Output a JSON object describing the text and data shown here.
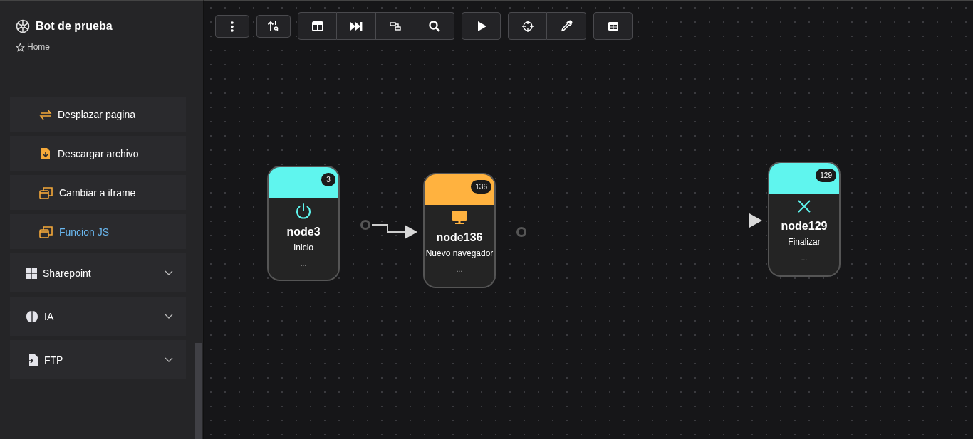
{
  "sidebar": {
    "title": "Bot de prueba",
    "breadcrumb": "Home",
    "items": [
      {
        "kind": "action",
        "label": "Desplazar pagina",
        "selected": false
      },
      {
        "kind": "action",
        "label": "Descargar archivo",
        "selected": false
      },
      {
        "kind": "action",
        "label": "Cambiar a iframe",
        "selected": false
      },
      {
        "kind": "action",
        "label": "Funcion JS",
        "selected": true
      },
      {
        "kind": "group",
        "label": "Sharepoint",
        "expanded": false
      },
      {
        "kind": "group",
        "label": "IA",
        "expanded": false
      },
      {
        "kind": "group",
        "label": "FTP",
        "expanded": false
      }
    ]
  },
  "canvas": {
    "nodes": [
      {
        "name": "node3",
        "label": "Inicio",
        "badge": "3",
        "color": "#5ff5ee",
        "input": false,
        "output": true,
        "footer": "..."
      },
      {
        "name": "node136",
        "label": "Nuevo navegador",
        "badge": "136",
        "color": "#ffb23f",
        "input": true,
        "output": true,
        "footer": "..."
      },
      {
        "name": "node129",
        "label": "Finalizar",
        "badge": "129",
        "color": "#5ff5ee",
        "input": true,
        "output": false,
        "footer": "..."
      }
    ]
  }
}
